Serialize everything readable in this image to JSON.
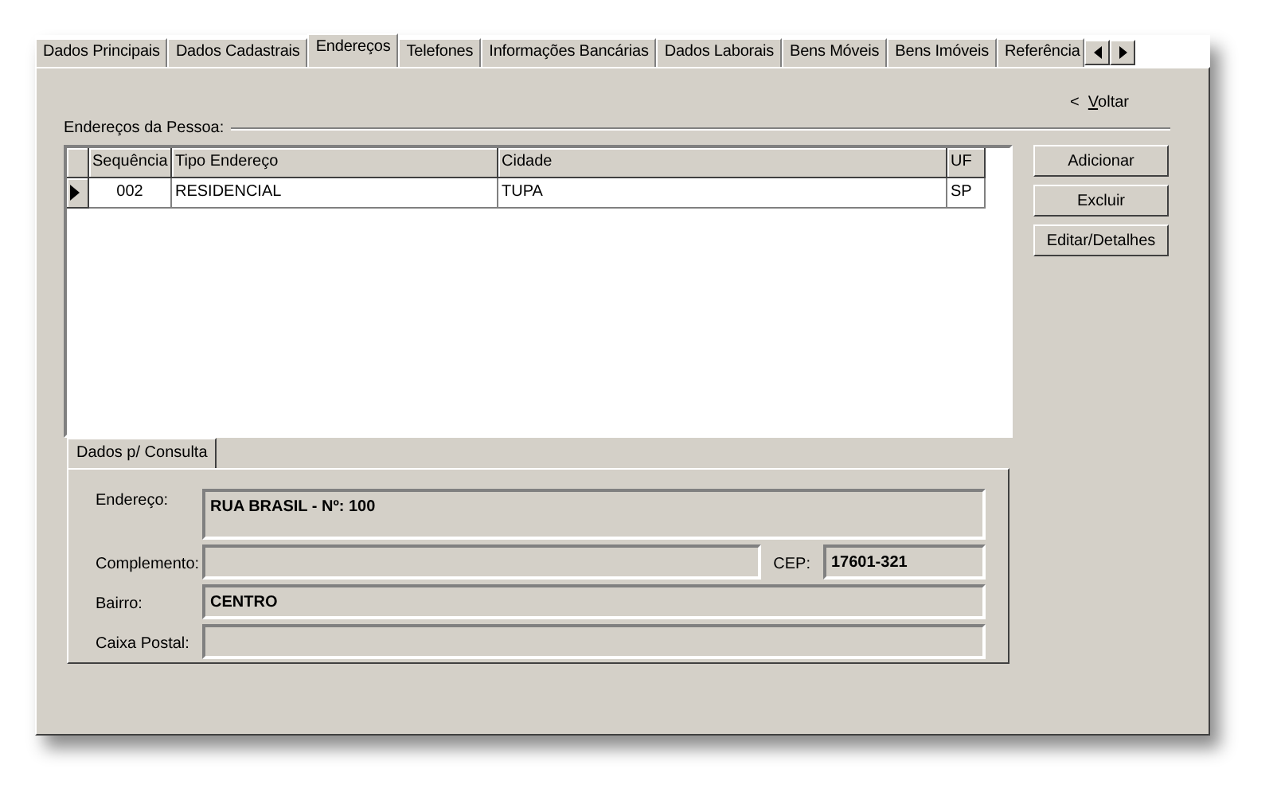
{
  "tabs": [
    {
      "label": "Dados Principais",
      "selected": false
    },
    {
      "label": "Dados Cadastrais",
      "selected": false
    },
    {
      "label": "Endereços",
      "selected": true
    },
    {
      "label": "Telefones",
      "selected": false
    },
    {
      "label": "Informações Bancárias",
      "selected": false
    },
    {
      "label": "Dados Laborais",
      "selected": false
    },
    {
      "label": "Bens Móveis",
      "selected": false
    },
    {
      "label": "Bens Imóveis",
      "selected": false
    },
    {
      "label": "Referência",
      "selected": false
    }
  ],
  "back_link": {
    "prefix": "<",
    "accelerator_key": "V",
    "label_rest": "oltar"
  },
  "group_title": "Endereços da Pessoa:",
  "table": {
    "columns": [
      "Sequência",
      "Tipo Endereço",
      "Cidade",
      "UF"
    ],
    "rows": [
      {
        "cells": [
          "002",
          "RESIDENCIAL",
          "TUPA",
          "SP"
        ],
        "current": true
      }
    ]
  },
  "buttons": [
    "Adicionar",
    "Excluir",
    "Editar/Detalhes"
  ],
  "subtabs": [
    {
      "label": "Dados p/ Consulta",
      "selected": true
    }
  ],
  "fields": [
    {
      "label": "Endereço:",
      "value": "RUA BRASIL - Nº: 100"
    },
    {
      "label": "Complemento:",
      "extra": {
        "label": "CEP:",
        "value": "17601-321"
      }
    },
    {
      "label": "Bairro:",
      "value": "CENTRO"
    },
    {
      "label": "Caixa Postal:"
    }
  ]
}
